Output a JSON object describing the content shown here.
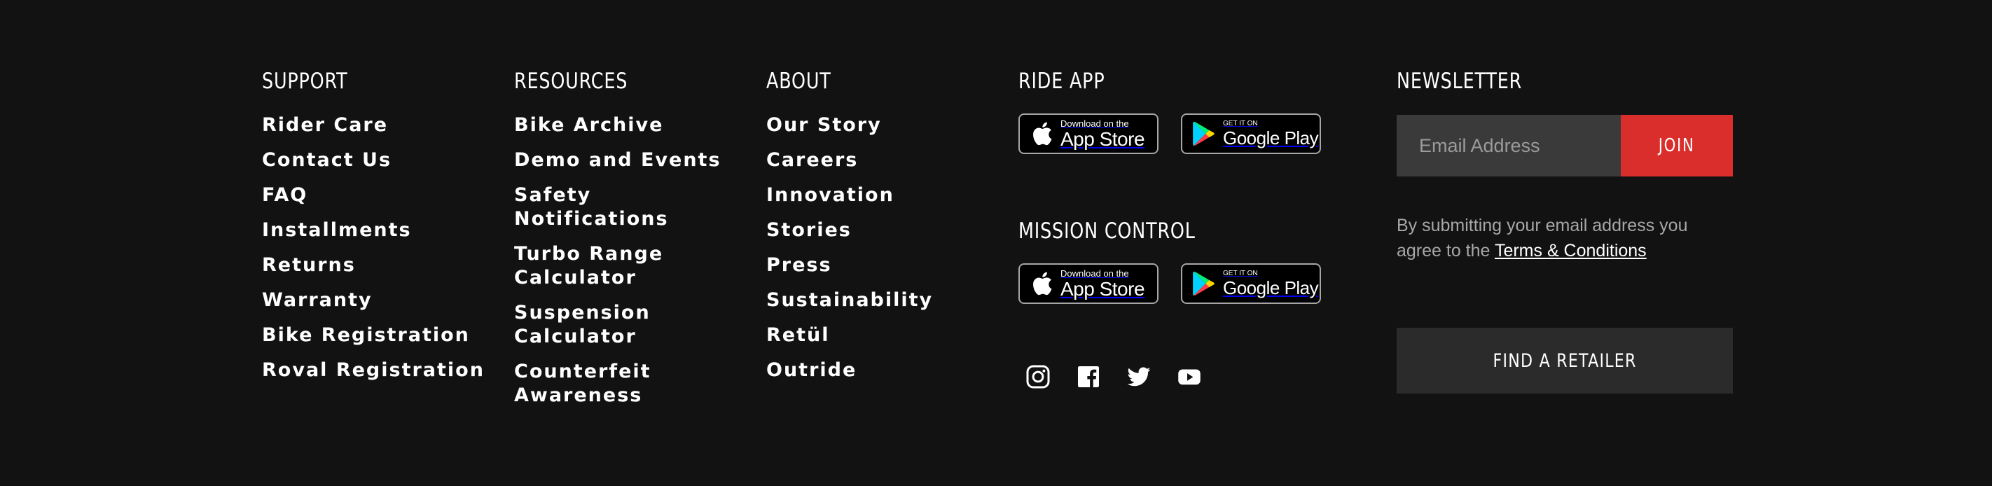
{
  "support": {
    "heading": "SUPPORT",
    "items": [
      "Rider Care",
      "Contact Us",
      "FAQ",
      "Installments",
      "Returns",
      "Warranty",
      "Bike Registration",
      "Roval Registration"
    ]
  },
  "resources": {
    "heading": "RESOURCES",
    "items": [
      "Bike Archive",
      "Demo and Events",
      "Safety Notifications",
      "Turbo Range Calculator",
      "Suspension Calculator",
      "Counterfeit Awareness"
    ]
  },
  "about": {
    "heading": "ABOUT",
    "items": [
      "Our Story",
      "Careers",
      "Innovation",
      "Stories",
      "Press",
      "Sustainability",
      "Retül",
      "Outride"
    ]
  },
  "ride_app": {
    "heading": "RIDE APP",
    "app_store": {
      "small": "Download on the",
      "big": "App Store"
    },
    "google_play": {
      "small": "GET IT ON",
      "big": "Google Play"
    }
  },
  "mission_control": {
    "heading": "MISSION CONTROL",
    "app_store": {
      "small": "Download on the",
      "big": "App Store"
    },
    "google_play": {
      "small": "GET IT ON",
      "big": "Google Play"
    }
  },
  "social": {
    "icons": [
      "instagram-icon",
      "facebook-icon",
      "twitter-icon",
      "youtube-icon"
    ]
  },
  "newsletter": {
    "heading": "NEWSLETTER",
    "email_placeholder": "Email Address",
    "email_value": "",
    "join_label": "JOIN",
    "disclaimer_prefix": "By submitting your email address you agree to the",
    "terms_link": "Terms & Conditions"
  },
  "retailer": {
    "label": "FIND A RETAILER"
  },
  "colors": {
    "background": "#121212",
    "accent": "#d92e2b",
    "input_bg": "#3a3a3a",
    "button_bg": "#2b2b2b",
    "muted_text": "#a7a7a7"
  }
}
